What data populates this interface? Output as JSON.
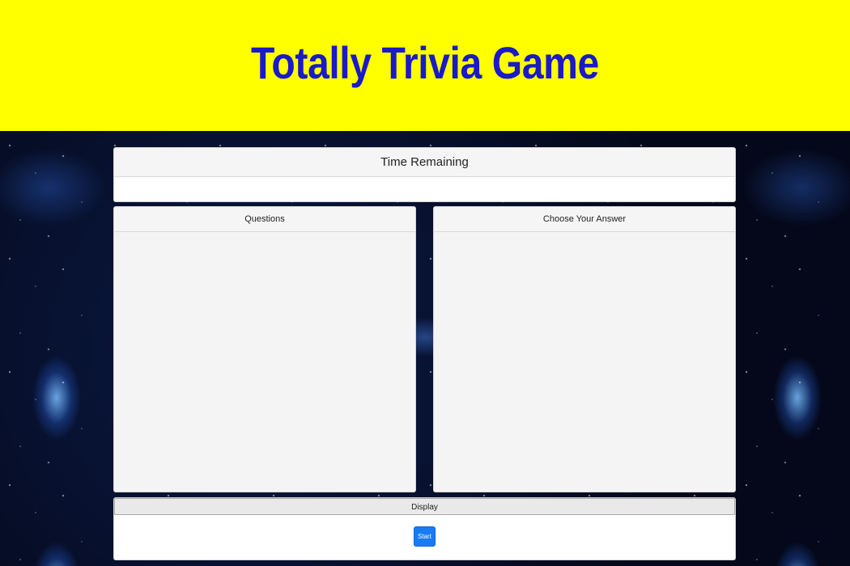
{
  "header": {
    "title": "Totally Trivia Game"
  },
  "timer": {
    "label": "Time Remaining",
    "value": ""
  },
  "questions": {
    "label": "Questions",
    "content": ""
  },
  "answers": {
    "label": "Choose Your Answer",
    "content": ""
  },
  "display": {
    "label": "Display",
    "start_label": "Start"
  },
  "colors": {
    "header_bg": "#ffff00",
    "title_color": "#1a1ac8",
    "start_button": "#1a7cf5"
  }
}
